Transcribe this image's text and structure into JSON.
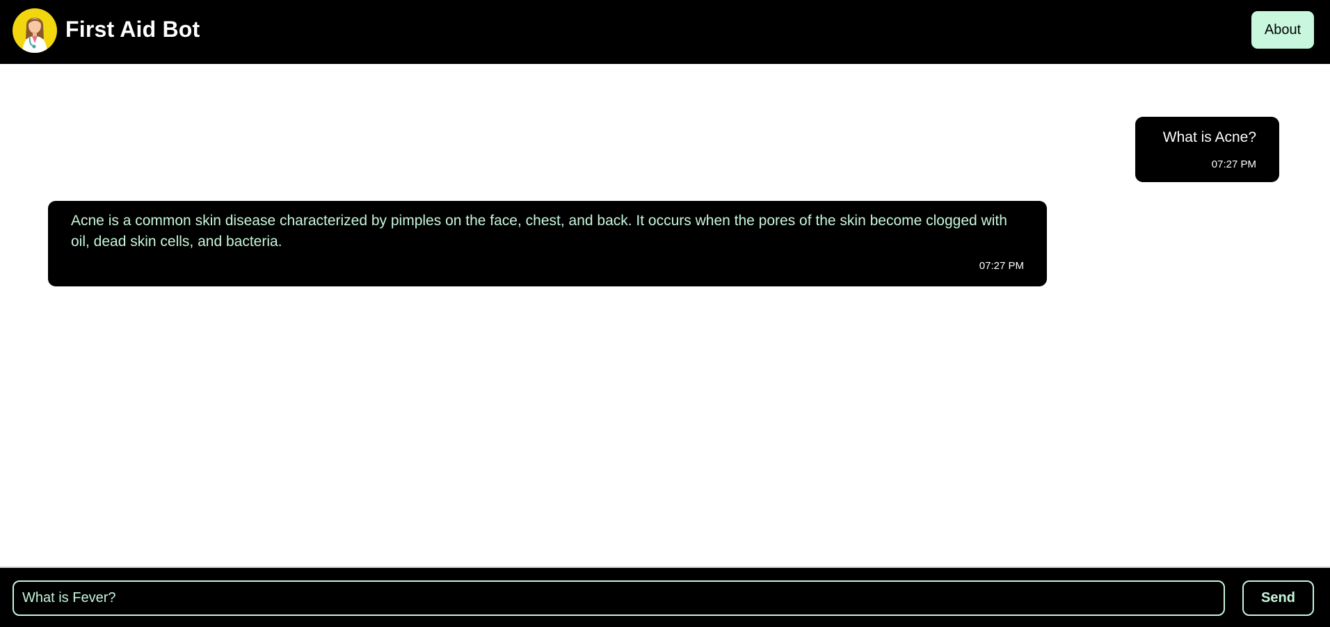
{
  "header": {
    "title": "First Aid Bot",
    "about_label": "About",
    "avatar_icon": "doctor-avatar-icon"
  },
  "messages": [
    {
      "sender": "user",
      "text": "What is Acne?",
      "time": "07:27 PM"
    },
    {
      "sender": "bot",
      "text": "Acne is a common skin disease characterized by pimples on the face, chest, and back. It occurs when the pores of the skin become clogged with oil, dead skin cells, and bacteria.",
      "time": "07:27 PM"
    }
  ],
  "composer": {
    "value": "What is Fever?",
    "send_label": "Send"
  },
  "colors": {
    "header_bg": "#000000",
    "accent_mint": "#c8f7dd",
    "avatar_bg": "#f2d70f",
    "chat_bg": "#ffffff"
  }
}
